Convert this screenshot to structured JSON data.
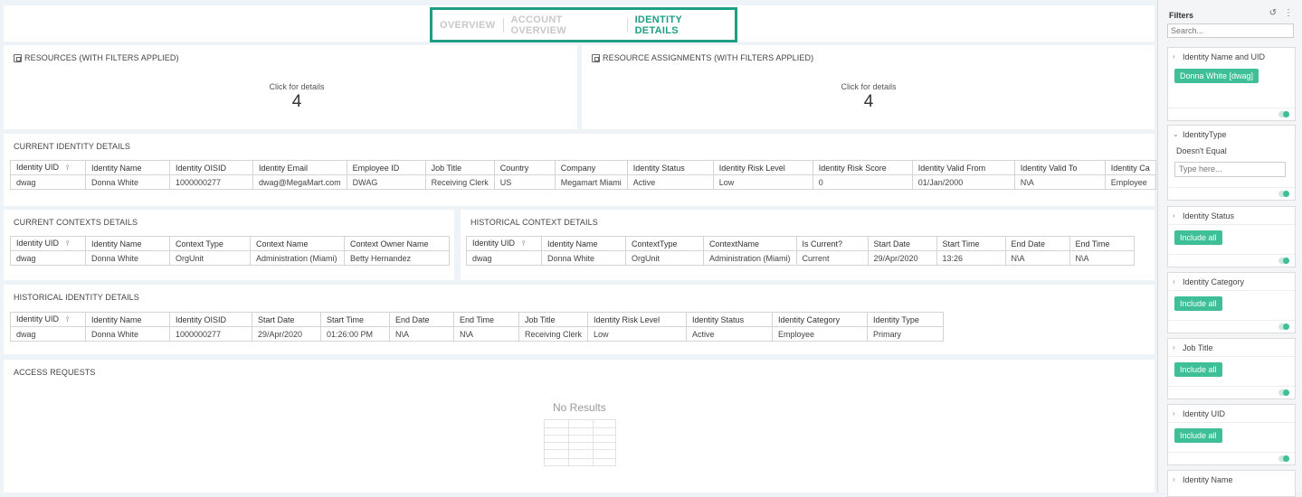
{
  "tabs": [
    {
      "label": "OVERVIEW",
      "active": false
    },
    {
      "label": "ACCOUNT OVERVIEW",
      "active": false
    },
    {
      "label": "IDENTITY DETAILS",
      "active": true
    }
  ],
  "accent_color": "#1d9e85",
  "resources": {
    "title": "RESOURCES (WITH FILTERS APPLIED)",
    "label": "Click for details",
    "value": "4"
  },
  "assignments": {
    "title": "RESOURCE ASSIGNMENTS (WITH FILTERS APPLIED)",
    "label": "Click for details",
    "value": "4"
  },
  "current_identity": {
    "title": "CURRENT IDENTITY DETAILS",
    "headers": [
      "Identity UID",
      "Identity Name",
      "Identity OISID",
      "Identity Email",
      "Employee ID",
      "Job Title",
      "Country",
      "Company",
      "Identity Status",
      "Identity Risk Level",
      "Identity Risk Score",
      "Identity Valid From",
      "Identity Valid To",
      "Identity Ca"
    ],
    "rows": [
      [
        "dwag",
        "Donna White",
        "1000000277",
        "dwag@MegaMart.com",
        "DWAG",
        "Receiving Clerk",
        "US",
        "Megamart Miami",
        "Active",
        "Low",
        "0",
        "01/Jan/2000",
        "N\\A",
        "Employee"
      ]
    ]
  },
  "current_contexts": {
    "title": "CURRENT CONTEXTS DETAILS",
    "headers": [
      "Identity UID",
      "Identity Name",
      "Context Type",
      "Context Name",
      "Context Owner Name"
    ],
    "rows": [
      [
        "dwag",
        "Donna White",
        "OrgUnit",
        "Administration (Miami)",
        "Betty Hernandez"
      ]
    ]
  },
  "historical_context": {
    "title": "HISTORICAL CONTEXT DETAILS",
    "headers": [
      "Identity UID",
      "Identity Name",
      "ContextType",
      "ContextName",
      "Is Current?",
      "Start Date",
      "Start Time",
      "End Date",
      "End Time"
    ],
    "rows": [
      [
        "dwag",
        "Donna White",
        "OrgUnit",
        "Administration (Miami)",
        "Current",
        "29/Apr/2020",
        "13:26",
        "N\\A",
        "N\\A"
      ]
    ]
  },
  "historical_identity": {
    "title": "HISTORICAL IDENTITY DETAILS",
    "headers": [
      "Identity UID",
      "Identity Name",
      "Identity OISID",
      "Start Date",
      "Start Time",
      "End Date",
      "End Time",
      "Job Title",
      "Identity Risk Level",
      "Identity Status",
      "Identity Category",
      "Identity Type"
    ],
    "rows": [
      [
        "dwag",
        "Donna White",
        "1000000277",
        "29/Apr/2020",
        "01:26:00 PM",
        "N\\A",
        "N\\A",
        "Receiving Clerk",
        "Low",
        "Active",
        "Employee",
        "Primary"
      ]
    ]
  },
  "access_requests": {
    "title": "ACCESS REQUESTS",
    "empty": "No Results"
  },
  "filters": {
    "title": "Filters",
    "search_placeholder": "Search...",
    "items": [
      {
        "label": "Identity Name and UID",
        "value": "Donna White [dwag]"
      },
      {
        "label": "IdentityType",
        "operator": "Doesn't Equal",
        "placeholder": "Type here..."
      },
      {
        "label": "Identity Status",
        "value": "Include all"
      },
      {
        "label": "Identity Category",
        "value": "Include all"
      },
      {
        "label": "Job Title",
        "value": "Include all"
      },
      {
        "label": "Identity UID",
        "value": "Include all"
      },
      {
        "label": "Identity Name"
      }
    ]
  }
}
